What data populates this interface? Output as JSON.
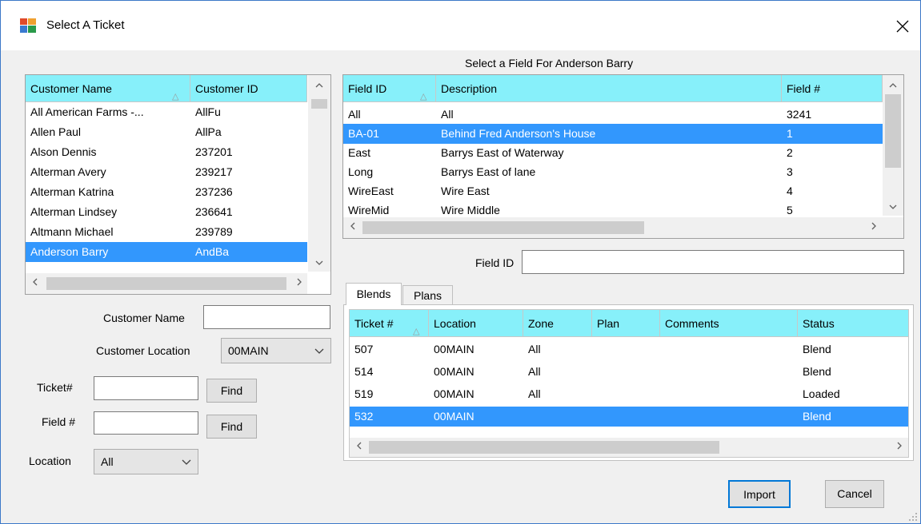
{
  "window": {
    "title": "Select A Ticket"
  },
  "field_section": {
    "heading": "Select a Field For Anderson Barry"
  },
  "customers": {
    "columns": [
      "Customer Name",
      "Customer ID"
    ],
    "rows": [
      {
        "name": "All American Farms -...",
        "id": "AllFu",
        "selected": false
      },
      {
        "name": "Allen Paul",
        "id": "AllPa",
        "selected": false
      },
      {
        "name": "Alson Dennis",
        "id": "237201",
        "selected": false
      },
      {
        "name": "Alterman Avery",
        "id": "239217",
        "selected": false
      },
      {
        "name": "Alterman Katrina",
        "id": "237236",
        "selected": false
      },
      {
        "name": "Alterman Lindsey",
        "id": "236641",
        "selected": false
      },
      {
        "name": "Altmann Michael",
        "id": "239789",
        "selected": false
      },
      {
        "name": "Anderson Barry",
        "id": "AndBa",
        "selected": true
      }
    ]
  },
  "fields": {
    "columns": [
      "Field ID",
      "Description",
      "Field #"
    ],
    "rows": [
      {
        "field_id": "All",
        "description": "All",
        "number": "3241",
        "selected": false
      },
      {
        "field_id": "BA-01",
        "description": "Behind Fred Anderson's House",
        "number": "1",
        "selected": true
      },
      {
        "field_id": "East",
        "description": "Barrys East of Waterway",
        "number": "2",
        "selected": false
      },
      {
        "field_id": "Long",
        "description": "Barrys East of lane",
        "number": "3",
        "selected": false
      },
      {
        "field_id": "WireEast",
        "description": "Wire East",
        "number": "4",
        "selected": false
      },
      {
        "field_id": "WireMid",
        "description": "Wire Middle",
        "number": "5",
        "selected": false
      }
    ]
  },
  "filters": {
    "customer_name_label": "Customer Name",
    "customer_name_value": "",
    "customer_location_label": "Customer Location",
    "customer_location_value": "00MAIN",
    "ticket_label": "Ticket#",
    "ticket_value": "",
    "field_number_label": "Field #",
    "field_number_value": "",
    "find_label": "Find",
    "location_label": "Location",
    "location_value": "All",
    "field_id_label": "Field ID",
    "field_id_value": ""
  },
  "tabs": [
    "Blends",
    "Plans"
  ],
  "tickets": {
    "columns": [
      "Ticket #",
      "Location",
      "Zone",
      "Plan",
      "Comments",
      "Status"
    ],
    "rows": [
      {
        "ticket": "507",
        "location": "00MAIN",
        "zone": "All",
        "plan": "",
        "comments": "",
        "status": "Blend",
        "selected": false
      },
      {
        "ticket": "514",
        "location": "00MAIN",
        "zone": "All",
        "plan": "",
        "comments": "",
        "status": "Blend",
        "selected": false
      },
      {
        "ticket": "519",
        "location": "00MAIN",
        "zone": "All",
        "plan": "",
        "comments": "",
        "status": "Loaded",
        "selected": false
      },
      {
        "ticket": "532",
        "location": "00MAIN",
        "zone": "",
        "plan": "",
        "comments": "",
        "status": "Blend",
        "selected": true
      }
    ]
  },
  "buttons": {
    "import": "Import",
    "cancel": "Cancel"
  },
  "colors": {
    "header": "#87f0fa",
    "selection": "#3297fd",
    "window_border": "#3c78c8"
  },
  "icons": [
    "app-icon",
    "close-icon",
    "sort-ascending-icon",
    "chevron-down-icon",
    "scroll-up-icon",
    "scroll-down-icon",
    "scroll-left-icon",
    "scroll-right-icon",
    "resize-grip-icon"
  ]
}
